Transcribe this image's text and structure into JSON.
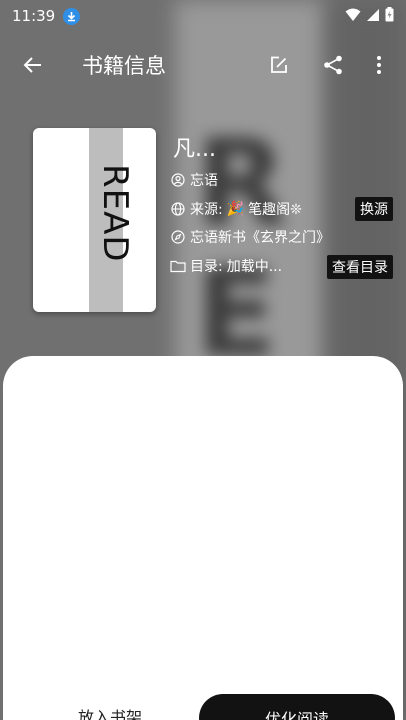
{
  "status_bar": {
    "time": "11:39",
    "icons": [
      "download-icon",
      "wifi-icon",
      "signal-icon",
      "battery-icon"
    ]
  },
  "app_bar": {
    "title": "书籍信息",
    "icons": [
      "back-arrow-icon",
      "edit-icon",
      "share-icon",
      "more-vert-icon"
    ]
  },
  "cover": {
    "text": "READ"
  },
  "book": {
    "name": "凡...",
    "author": "忘语",
    "source_label": "来源:",
    "source_emoji": "🎉",
    "source_value": "笔趣阁❊",
    "intro": "忘语新书《玄界之门》",
    "toc_label": "目录:",
    "toc_value": "加载中..."
  },
  "actions": {
    "change_source": "换源",
    "view_toc": "查看目录",
    "add_to_shelf": "放入书架",
    "read": "优化阅读"
  },
  "colors": {
    "pill_bg": "#121212",
    "sheet_bg": "#ffffff",
    "primary_button_bg": "#121212"
  }
}
